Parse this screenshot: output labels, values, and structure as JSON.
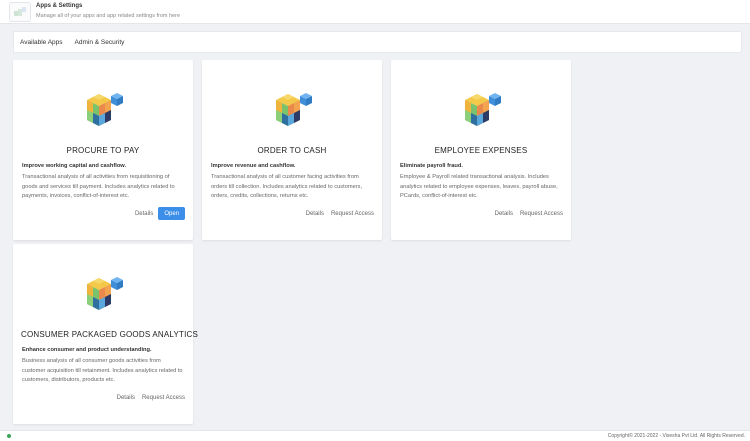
{
  "header": {
    "title": "Apps & Settings",
    "subtitle": "Manage all of your apps and app related settings from here",
    "logo_icon": "apps-logo-icon"
  },
  "tabs": [
    {
      "label": "Available Apps"
    },
    {
      "label": "Admin & Security"
    }
  ],
  "cards": [
    {
      "title": "PROCURE TO PAY",
      "subtitle": "Improve working capital and cashflow.",
      "description": "Transactional analysis of all activities from requisitioning of goods and services till payment. Includes analytics related to payments, invoices, conflict-of-interest etc.",
      "details_label": "Details",
      "action_label": "Open",
      "icon": "cube-stack-icon"
    },
    {
      "title": "ORDER TO CASH",
      "subtitle": "Improve revenue and cashflow.",
      "description": "Transactional analysis of all customer facing activities from orders till collection. Includes analytics related to customers, orders, credits, collections, returns etc.",
      "details_label": "Details",
      "action_label": "Request Access",
      "icon": "cube-stack-icon"
    },
    {
      "title": "EMPLOYEE EXPENSES",
      "subtitle": "Eliminate payroll fraud.",
      "description": "Employee & Payroll related transactional analysis. Includes analytics related to employee expenses, leaves, payroll abuse, PCards, conflict-of-interest etc.",
      "details_label": "Details",
      "action_label": "Request Access",
      "icon": "cube-stack-icon"
    },
    {
      "title": "CONSUMER PACKAGED GOODS ANALYTICS",
      "subtitle": "Enhance consumer and product understanding.",
      "description": "Business analysis of all consumer goods activities from customer acquisition till retainment. Includes analytics related to customers, distributors, products etc.",
      "details_label": "Details",
      "action_label": "Request Access",
      "icon": "cube-stack-icon"
    }
  ],
  "footer": {
    "copyright": "Copyright© 2021-2022 - Visesha Pvt Ltd. All Rights Reserved.",
    "status_color": "#3aa65a"
  },
  "colors": {
    "accent": "#3c8fe8",
    "background": "#f0f1f4"
  }
}
